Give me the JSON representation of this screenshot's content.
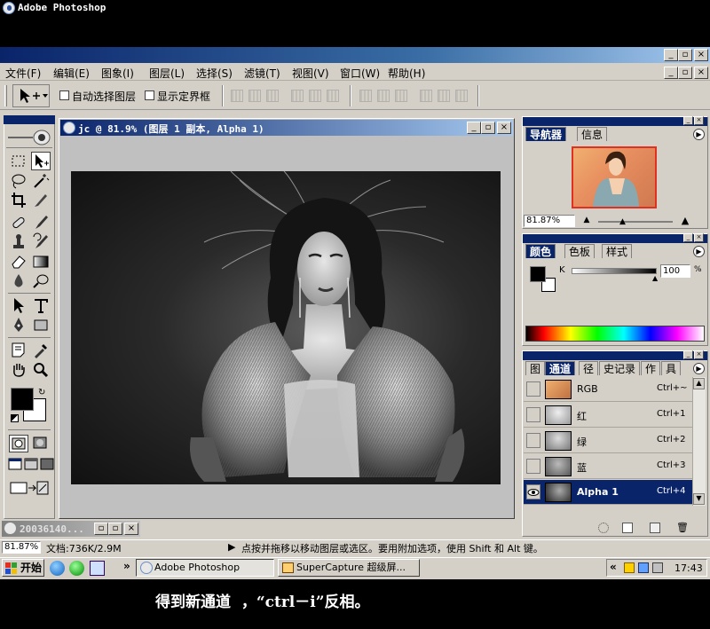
{
  "app": {
    "title": "Adobe Photoshop",
    "window_controls": [
      "_",
      "▫",
      "×"
    ]
  },
  "menubar": {
    "items": [
      "文件(F)",
      "编辑(E)",
      "图象(I)",
      "图层(L)",
      "选择(S)",
      "滤镜(T)",
      "视图(V)",
      "窗口(W)",
      "帮助(H)"
    ]
  },
  "options": {
    "auto_select_label": "自动选择图层",
    "show_bounds_label": "显示定界框"
  },
  "document": {
    "title": "jc @ 81.9% (图层 1 副本, Alpha 1)"
  },
  "navigator": {
    "tabs": [
      "导航器",
      "信息"
    ],
    "zoom": "81.87%"
  },
  "color_panel": {
    "tabs": [
      "颜色",
      "色板",
      "样式"
    ],
    "channel_label": "K",
    "value": "100",
    "unit": "%",
    "slider_fraction": 1.0
  },
  "channels_panel": {
    "tabs": [
      "图",
      "通道",
      "径",
      "史记录",
      "作",
      "具"
    ],
    "rows": [
      {
        "name": "RGB",
        "shortcut": "Ctrl+~",
        "visible": false,
        "selected": false
      },
      {
        "name": "红",
        "shortcut": "Ctrl+1",
        "visible": false,
        "selected": false
      },
      {
        "name": "绿",
        "shortcut": "Ctrl+2",
        "visible": false,
        "selected": false
      },
      {
        "name": "蓝",
        "shortcut": "Ctrl+3",
        "visible": false,
        "selected": false
      },
      {
        "name": "Alpha 1",
        "shortcut": "Ctrl+4",
        "visible": true,
        "selected": true
      }
    ]
  },
  "minimized_doc": {
    "title": "20036140..."
  },
  "statusbar": {
    "zoom": "81.87%",
    "doc_info": "文档:736K/2.9M",
    "hint": "点按并拖移以移动图层或选区。要用附加选项，使用 Shift 和 Alt 键。"
  },
  "taskbar": {
    "start_label": "开始",
    "tasks": [
      "Adobe Photoshop",
      "SuperCapture 超级屏..."
    ],
    "clock": "17:43",
    "chevron": "»",
    "tray_chevron": "«"
  },
  "caption": {
    "text": "得到新通道  ，“ctrl－i”反相。"
  },
  "colors": {
    "title_blue": "#0a246a",
    "chrome": "#d4d0c8",
    "foreground": "#000000",
    "background": "#ffffff"
  }
}
